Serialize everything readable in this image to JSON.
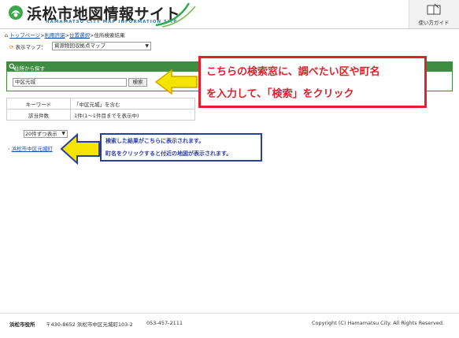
{
  "header": {
    "site_title": "浜松市地図情報サイト",
    "site_subtitle": "HAMAMATSU CITY MAP INFORMATION SITE",
    "guide_label": "使い方ガイド"
  },
  "breadcrumb": {
    "items": [
      "トップページ",
      "利用許諾",
      "位置選択",
      "住所検索結果"
    ],
    "separator": ">"
  },
  "map_select": {
    "label": "表示マップ：",
    "value": "資源物回収拠点マップ"
  },
  "search_panel": {
    "title": "住所から探す",
    "input_value": "中区元城",
    "button_label": "検索"
  },
  "result_table": {
    "rows": [
      {
        "label": "キーワード",
        "value": "「中区元城」を含む"
      },
      {
        "label": "該当件数",
        "value": "1件(1～1件目までを表示中)"
      }
    ]
  },
  "per_page": {
    "value": "20件ずつ表示"
  },
  "results": [
    {
      "label": "浜松市中区元城町"
    }
  ],
  "callouts": {
    "red_line1": "こちらの検索窓に、調べたい区や町名",
    "red_line2": "を入力して、「検索」をクリック",
    "blue_line1": "検索した結果がこちらに表示されます。",
    "blue_line2": "町名をクリックすると付近の地図が表示されます。"
  },
  "footer": {
    "org": "浜松市役所",
    "address": "〒430-8652 浜松市中区元城町103-2",
    "tel": "053-457-2111",
    "copyright": "Copyright (C) Hamamatsu City. All Rights Reserved."
  },
  "colors": {
    "panel_green": "#3e8e41",
    "callout_red": "#e0202a",
    "callout_blue": "#2b3ba8",
    "arrow_yellow": "#f5e400",
    "link_blue": "#1a4fa0"
  }
}
